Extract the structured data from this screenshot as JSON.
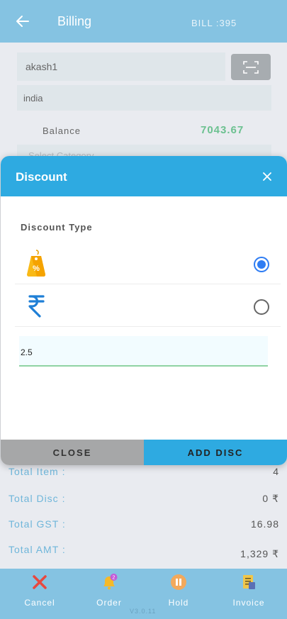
{
  "header": {
    "title": "Billing",
    "bill_no": "BILL :395"
  },
  "customer": {
    "name": "akash1",
    "country": "india"
  },
  "balance": {
    "label": "Balance",
    "value": "7043.67"
  },
  "category": {
    "placeholder": "Select Category"
  },
  "summary": [
    {
      "label": "Total Item :",
      "value": "4"
    },
    {
      "label": "Total Disc :",
      "value": "0 ₹"
    },
    {
      "label": "Total GST :",
      "value": "16.98"
    },
    {
      "label": "Total AMT :",
      "value": "1,329 ₹"
    }
  ],
  "bottom_nav": [
    {
      "label": "Cancel",
      "icon": "close-icon"
    },
    {
      "label": "Order",
      "icon": "bell-icon",
      "badge": "2"
    },
    {
      "label": "Hold",
      "icon": "pause-icon"
    },
    {
      "label": "Invoice",
      "icon": "invoice-icon"
    }
  ],
  "version": "V3.0.11",
  "modal": {
    "title": "Discount",
    "discount_type_label": "Discount Type",
    "options": [
      {
        "icon": "percent-tag-icon",
        "selected": true
      },
      {
        "icon": "rupee-icon",
        "selected": false
      }
    ],
    "input_value": "2.5",
    "close_label": "CLOSE",
    "add_label": "ADD DISC"
  },
  "colors": {
    "header_bg": "#85c3e2",
    "accent": "#2eaae1",
    "balance_green": "#6cc190",
    "radio_blue": "#2f7df3"
  }
}
